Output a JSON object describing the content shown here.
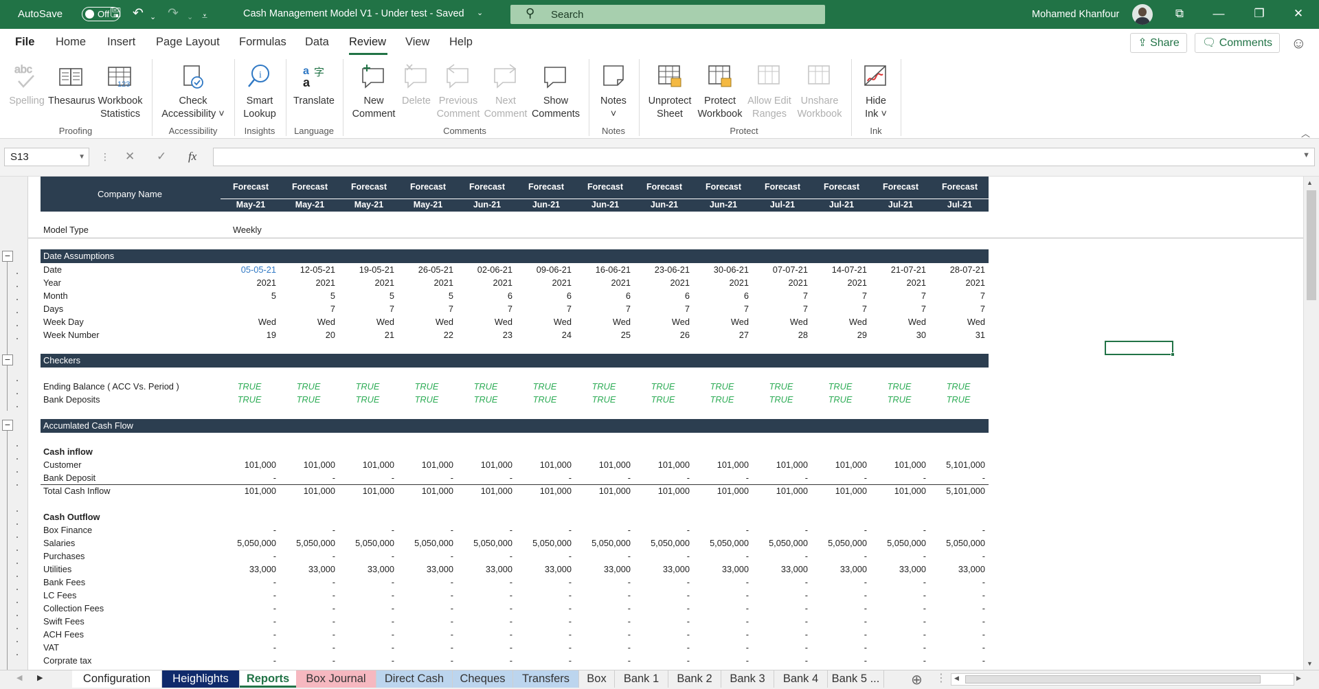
{
  "titlebar": {
    "autosave_label": "AutoSave",
    "autosave_state": "Off",
    "doc_title": "Cash Management Model V1 - Under test  -  Saved",
    "search_placeholder": "Search",
    "user_name": "Mohamed Khanfour"
  },
  "menu": {
    "tabs": [
      "File",
      "Home",
      "Insert",
      "Page Layout",
      "Formulas",
      "Data",
      "Review",
      "View",
      "Help"
    ],
    "active_tab": "Review",
    "share_label": "Share",
    "comments_label": "Comments"
  },
  "ribbon": {
    "buttons": [
      {
        "l1": "Spelling",
        "l2": "",
        "disabled": true
      },
      {
        "l1": "Thesaurus",
        "l2": ""
      },
      {
        "l1": "Workbook",
        "l2": "Statistics"
      },
      {
        "l1": "Check",
        "l2": "Accessibility ˅"
      },
      {
        "l1": "Smart",
        "l2": "Lookup"
      },
      {
        "l1": "Translate",
        "l2": ""
      },
      {
        "l1": "New",
        "l2": "Comment"
      },
      {
        "l1": "Delete",
        "l2": "",
        "disabled": true
      },
      {
        "l1": "Previous",
        "l2": "Comment",
        "disabled": true
      },
      {
        "l1": "Next",
        "l2": "Comment",
        "disabled": true
      },
      {
        "l1": "Show",
        "l2": "Comments"
      },
      {
        "l1": "Notes",
        "l2": "˅"
      },
      {
        "l1": "Unprotect",
        "l2": "Sheet"
      },
      {
        "l1": "Protect",
        "l2": "Workbook"
      },
      {
        "l1": "Allow Edit",
        "l2": "Ranges",
        "disabled": true
      },
      {
        "l1": "Unshare",
        "l2": "Workbook",
        "disabled": true
      },
      {
        "l1": "Hide",
        "l2": "Ink ˅"
      }
    ],
    "groups": [
      "Proofing",
      "Accessibility",
      "Insights",
      "Language",
      "Comments",
      "Notes",
      "Protect",
      "Ink"
    ]
  },
  "formula_bar": {
    "name_box": "S13",
    "formula": ""
  },
  "sheet": {
    "company_label": "Company Name",
    "header_top": [
      "Forecast",
      "Forecast",
      "Forecast",
      "Forecast",
      "Forecast",
      "Forecast",
      "Forecast",
      "Forecast",
      "Forecast",
      "Forecast",
      "Forecast",
      "Forecast",
      "Forecast"
    ],
    "header_bottom": [
      "May-21",
      "May-21",
      "May-21",
      "May-21",
      "Jun-21",
      "Jun-21",
      "Jun-21",
      "Jun-21",
      "Jun-21",
      "Jul-21",
      "Jul-21",
      "Jul-21",
      "Jul-21"
    ],
    "model_type_label": "Model Type",
    "model_type_value": "Weekly",
    "date_section": {
      "title": "Date Assumptions",
      "rows": [
        {
          "label": "Date",
          "values": [
            "05-05-21",
            "12-05-21",
            "19-05-21",
            "26-05-21",
            "02-06-21",
            "09-06-21",
            "16-06-21",
            "23-06-21",
            "30-06-21",
            "07-07-21",
            "14-07-21",
            "21-07-21",
            "28-07-21"
          ]
        },
        {
          "label": "Year",
          "values": [
            "2021",
            "2021",
            "2021",
            "2021",
            "2021",
            "2021",
            "2021",
            "2021",
            "2021",
            "2021",
            "2021",
            "2021",
            "2021"
          ]
        },
        {
          "label": "Month",
          "values": [
            "5",
            "5",
            "5",
            "5",
            "6",
            "6",
            "6",
            "6",
            "6",
            "7",
            "7",
            "7",
            "7"
          ]
        },
        {
          "label": "Days",
          "values": [
            "",
            "7",
            "7",
            "7",
            "7",
            "7",
            "7",
            "7",
            "7",
            "7",
            "7",
            "7",
            "7"
          ]
        },
        {
          "label": "Week Day",
          "values": [
            "Wed",
            "Wed",
            "Wed",
            "Wed",
            "Wed",
            "Wed",
            "Wed",
            "Wed",
            "Wed",
            "Wed",
            "Wed",
            "Wed",
            "Wed"
          ]
        },
        {
          "label": "Week Number",
          "values": [
            "19",
            "20",
            "21",
            "22",
            "23",
            "24",
            "25",
            "26",
            "27",
            "28",
            "29",
            "30",
            "31"
          ]
        }
      ]
    },
    "checkers": {
      "title": "Checkers",
      "rows": [
        {
          "label": "Ending Balance ( ACC Vs. Period )",
          "values": [
            "TRUE",
            "TRUE",
            "TRUE",
            "TRUE",
            "TRUE",
            "TRUE",
            "TRUE",
            "TRUE",
            "TRUE",
            "TRUE",
            "TRUE",
            "TRUE",
            "TRUE"
          ]
        },
        {
          "label": "Bank Deposits",
          "values": [
            "TRUE",
            "TRUE",
            "TRUE",
            "TRUE",
            "TRUE",
            "TRUE",
            "TRUE",
            "TRUE",
            "TRUE",
            "TRUE",
            "TRUE",
            "TRUE",
            "TRUE"
          ]
        }
      ]
    },
    "cashflow": {
      "title": "Accumlated Cash Flow",
      "inflow_title": "Cash inflow",
      "inflow_rows": [
        {
          "label": "Customer",
          "values": [
            "101,000",
            "101,000",
            "101,000",
            "101,000",
            "101,000",
            "101,000",
            "101,000",
            "101,000",
            "101,000",
            "101,000",
            "101,000",
            "101,000",
            "5,101,000"
          ]
        },
        {
          "label": "Bank Deposit",
          "values": [
            "-",
            "-",
            "-",
            "-",
            "-",
            "-",
            "-",
            "-",
            "-",
            "-",
            "-",
            "-",
            "-"
          ]
        }
      ],
      "total_inflow": {
        "label": "Total Cash Inflow",
        "values": [
          "101,000",
          "101,000",
          "101,000",
          "101,000",
          "101,000",
          "101,000",
          "101,000",
          "101,000",
          "101,000",
          "101,000",
          "101,000",
          "101,000",
          "5,101,000"
        ]
      },
      "outflow_title": "Cash Outflow",
      "outflow_rows": [
        {
          "label": "Box Finance",
          "values": [
            "-",
            "-",
            "-",
            "-",
            "-",
            "-",
            "-",
            "-",
            "-",
            "-",
            "-",
            "-",
            "-"
          ]
        },
        {
          "label": "Salaries",
          "values": [
            "5,050,000",
            "5,050,000",
            "5,050,000",
            "5,050,000",
            "5,050,000",
            "5,050,000",
            "5,050,000",
            "5,050,000",
            "5,050,000",
            "5,050,000",
            "5,050,000",
            "5,050,000",
            "5,050,000"
          ]
        },
        {
          "label": "Purchases",
          "values": [
            "-",
            "-",
            "-",
            "-",
            "-",
            "-",
            "-",
            "-",
            "-",
            "-",
            "-",
            "-",
            "-"
          ]
        },
        {
          "label": "Utilities",
          "values": [
            "33,000",
            "33,000",
            "33,000",
            "33,000",
            "33,000",
            "33,000",
            "33,000",
            "33,000",
            "33,000",
            "33,000",
            "33,000",
            "33,000",
            "33,000"
          ]
        },
        {
          "label": "Bank Fees",
          "values": [
            "-",
            "-",
            "-",
            "-",
            "-",
            "-",
            "-",
            "-",
            "-",
            "-",
            "-",
            "-",
            "-"
          ]
        },
        {
          "label": "LC Fees",
          "values": [
            "-",
            "-",
            "-",
            "-",
            "-",
            "-",
            "-",
            "-",
            "-",
            "-",
            "-",
            "-",
            "-"
          ]
        },
        {
          "label": "Collection Fees",
          "values": [
            "-",
            "-",
            "-",
            "-",
            "-",
            "-",
            "-",
            "-",
            "-",
            "-",
            "-",
            "-",
            "-"
          ]
        },
        {
          "label": "Swift Fees",
          "values": [
            "-",
            "-",
            "-",
            "-",
            "-",
            "-",
            "-",
            "-",
            "-",
            "-",
            "-",
            "-",
            "-"
          ]
        },
        {
          "label": "ACH Fees",
          "values": [
            "-",
            "-",
            "-",
            "-",
            "-",
            "-",
            "-",
            "-",
            "-",
            "-",
            "-",
            "-",
            "-"
          ]
        },
        {
          "label": "VAT",
          "values": [
            "-",
            "-",
            "-",
            "-",
            "-",
            "-",
            "-",
            "-",
            "-",
            "-",
            "-",
            "-",
            "-"
          ]
        },
        {
          "label": "Corprate tax",
          "values": [
            "-",
            "-",
            "-",
            "-",
            "-",
            "-",
            "-",
            "-",
            "-",
            "-",
            "-",
            "-",
            "-"
          ]
        }
      ]
    }
  },
  "sheet_tabs": [
    {
      "label": "Configuration",
      "color": "#ffffff",
      "text": "#222222"
    },
    {
      "label": "Heighlights",
      "color": "#0f2a6b",
      "text": "#ffffff"
    },
    {
      "label": "Reports",
      "active": true
    },
    {
      "label": "Box Journal",
      "color": "#f6b8c0",
      "text": "#333333"
    },
    {
      "label": "Direct Cash",
      "color": "#bcd5ee",
      "text": "#333333"
    },
    {
      "label": "Cheques",
      "color": "#bcd5ee",
      "text": "#333333"
    },
    {
      "label": "Transfers",
      "color": "#bcd5ee",
      "text": "#333333"
    },
    {
      "label": "Box",
      "color": "#f0f0f0",
      "text": "#333333"
    },
    {
      "label": "Bank 1",
      "color": "#f0f0f0",
      "text": "#333333"
    },
    {
      "label": "Bank 2",
      "color": "#f0f0f0",
      "text": "#333333"
    },
    {
      "label": "Bank 3",
      "color": "#f0f0f0",
      "text": "#333333"
    },
    {
      "label": "Bank 4",
      "color": "#f0f0f0",
      "text": "#333333"
    },
    {
      "label": "Bank 5 ...",
      "color": "#f0f0f0",
      "text": "#333333"
    }
  ],
  "colors": {
    "accent": "#217346",
    "section_header": "#2c3e50",
    "true_value": "#2eac56"
  }
}
